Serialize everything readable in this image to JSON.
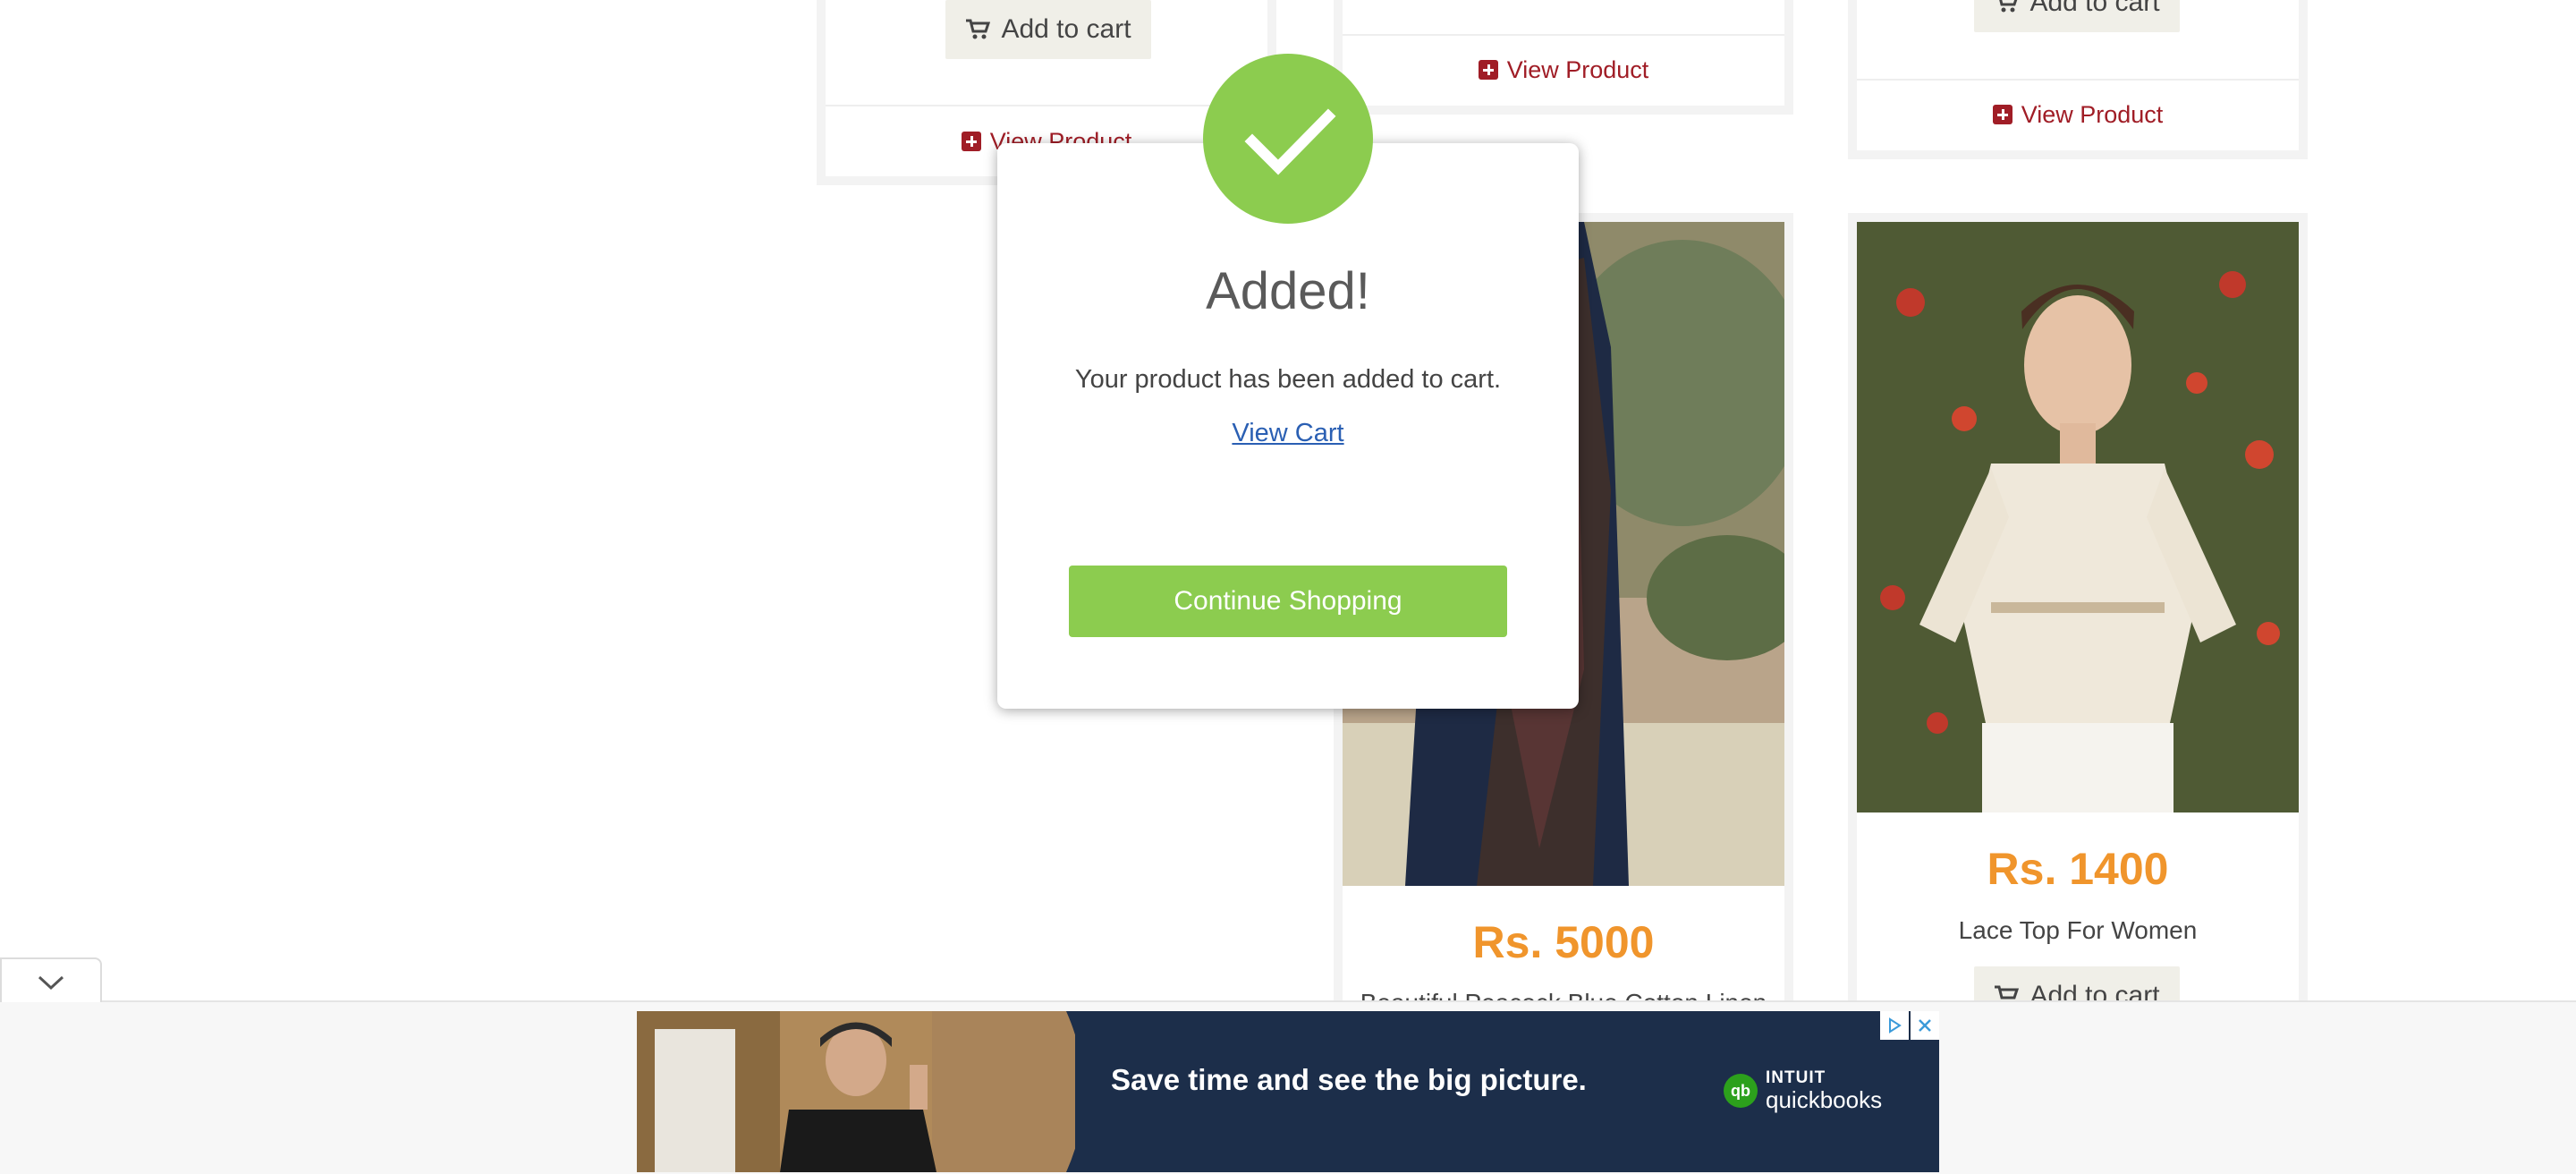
{
  "products": {
    "card1": {
      "add_to_cart": "Add to cart",
      "view_product": "View Product"
    },
    "card2": {
      "view_product": "View Product",
      "price": "Rs. 5000",
      "name": "Beautiful Peacock Blue Cotton Linen"
    },
    "card3": {
      "add_to_cart": "Add to cart",
      "view_product": "View Product",
      "price": "Rs. 1400",
      "name": "Lace Top For Women",
      "add_to_cart_bottom": "Add to cart"
    }
  },
  "modal": {
    "title": "Added!",
    "message": "Your product has been added to cart.",
    "view_cart": "View Cart",
    "continue_button": "Continue Shopping"
  },
  "ad": {
    "headline": "Save time and see the big picture.",
    "brand_top": "INTUIT",
    "brand": "quickbooks",
    "logo_text": "qb"
  },
  "colors": {
    "price": "#f0952c",
    "link": "#a01d26",
    "success": "#8ccc4f",
    "ad_background": "#1c2e4a"
  }
}
